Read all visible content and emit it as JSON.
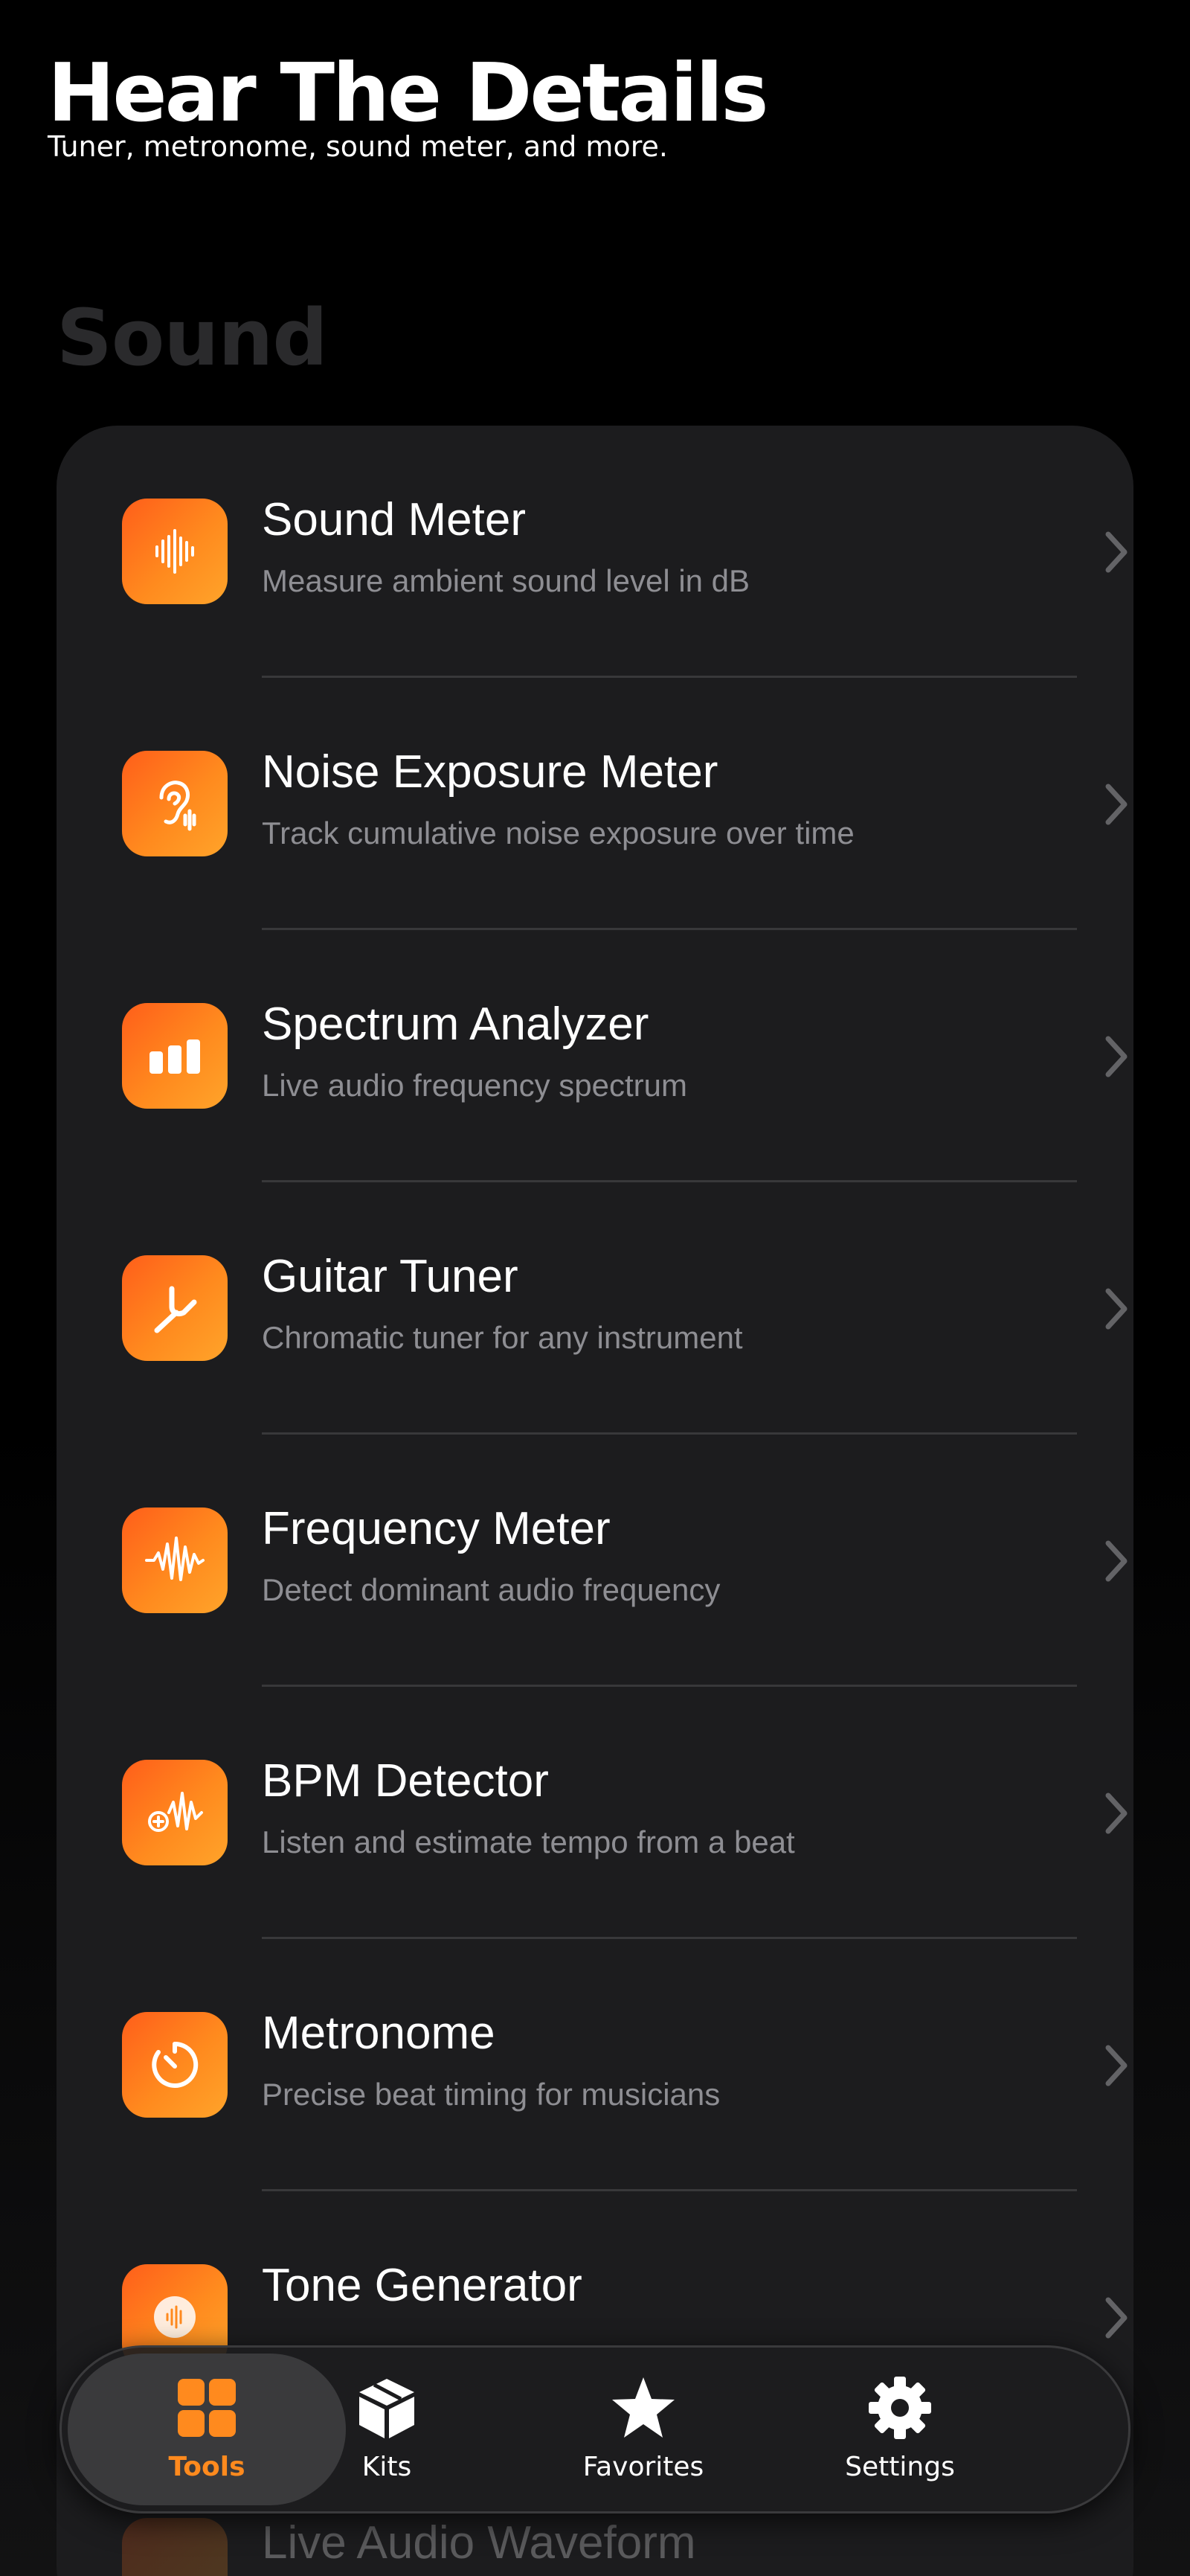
{
  "header": {
    "title": "Hear The Details",
    "subtitle": "Tuner, metronome, sound meter, and more."
  },
  "section": {
    "heading": "Sound"
  },
  "accent_color": "#ff8a1e",
  "tools": [
    {
      "title": "Sound Meter",
      "description": "Measure ambient sound level in dB",
      "icon": "waveform-icon"
    },
    {
      "title": "Noise Exposure Meter",
      "description": "Track cumulative noise exposure over time",
      "icon": "ear-icon"
    },
    {
      "title": "Spectrum Analyzer",
      "description": "Live audio frequency spectrum",
      "icon": "bars-icon"
    },
    {
      "title": "Guitar Tuner",
      "description": "Chromatic tuner for any instrument",
      "icon": "tuning-fork-icon"
    },
    {
      "title": "Frequency Meter",
      "description": "Detect dominant audio frequency",
      "icon": "frequency-wave-icon"
    },
    {
      "title": "BPM Detector",
      "description": "Listen and estimate tempo from a beat",
      "icon": "waveform-plus-icon"
    },
    {
      "title": "Metronome",
      "description": "Precise beat timing for musicians",
      "icon": "timer-icon"
    },
    {
      "title": "Tone Generator",
      "description": "",
      "icon": "tone-icon"
    },
    {
      "title": "Live Audio Waveform",
      "description": "",
      "icon": "waveform-icon"
    }
  ],
  "tab_bar": {
    "tabs": [
      {
        "label": "Tools",
        "icon": "grid-icon",
        "selected": true
      },
      {
        "label": "Kits",
        "icon": "box-icon",
        "selected": false
      },
      {
        "label": "Favorites",
        "icon": "star-icon",
        "selected": false
      },
      {
        "label": "Settings",
        "icon": "gear-icon",
        "selected": false
      }
    ]
  }
}
